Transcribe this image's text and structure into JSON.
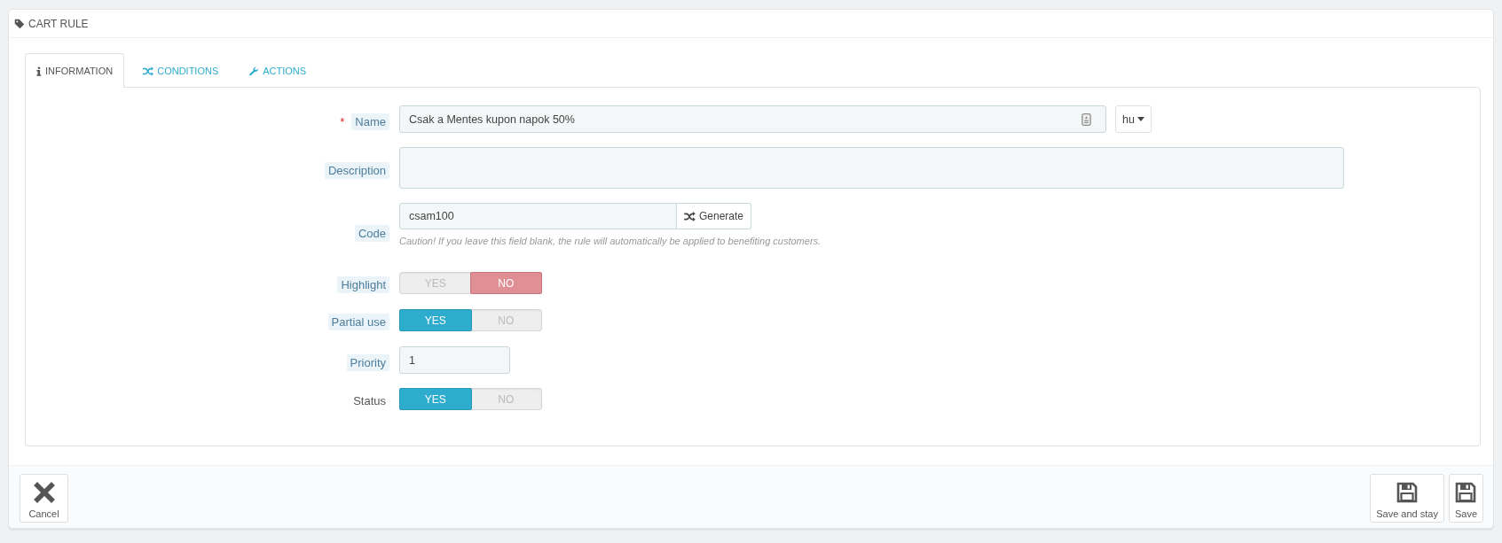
{
  "panel": {
    "title": "CART RULE"
  },
  "tabs": [
    {
      "label": "INFORMATION",
      "selected": true
    },
    {
      "label": "CONDITIONS",
      "selected": false
    },
    {
      "label": "ACTIONS",
      "selected": false
    }
  ],
  "form": {
    "fields": [
      {
        "kind": "translatable",
        "label": "Name",
        "hint": true,
        "marker": "*",
        "value": "Csak a Mentes kupon napok 50%",
        "language": "hu"
      },
      {
        "kind": "textarea",
        "label": "Description",
        "hint": true
      },
      {
        "kind": "generate",
        "label": "Code",
        "hint": true,
        "value": "csam100",
        "button": "Generate",
        "help": "Caution! If you leave this field blank, the rule will automatically be applied to benefiting customers."
      },
      {
        "kind": "switch",
        "label": "Highlight",
        "hint": true,
        "options": [
          {
            "kind": "yes",
            "label": "YES",
            "selected": false
          },
          {
            "kind": "no",
            "label": "NO",
            "selected": true
          }
        ]
      },
      {
        "kind": "switch",
        "label": "Partial use",
        "hint": true,
        "options": [
          {
            "kind": "yes",
            "label": "YES",
            "selected": true
          },
          {
            "kind": "no",
            "label": "NO",
            "selected": false
          }
        ]
      },
      {
        "kind": "short",
        "label": "Priority",
        "hint": true,
        "value": "1"
      },
      {
        "kind": "switch",
        "label": "Status",
        "hint": false,
        "options": [
          {
            "kind": "yes",
            "label": "YES",
            "selected": true
          },
          {
            "kind": "no",
            "label": "NO",
            "selected": false
          }
        ]
      }
    ]
  },
  "footer": {
    "buttons": [
      {
        "kind": "cancel",
        "label": "Cancel"
      },
      {
        "kind": "save",
        "label": "Save and stay"
      },
      {
        "kind": "save",
        "label": "Save"
      }
    ]
  }
}
